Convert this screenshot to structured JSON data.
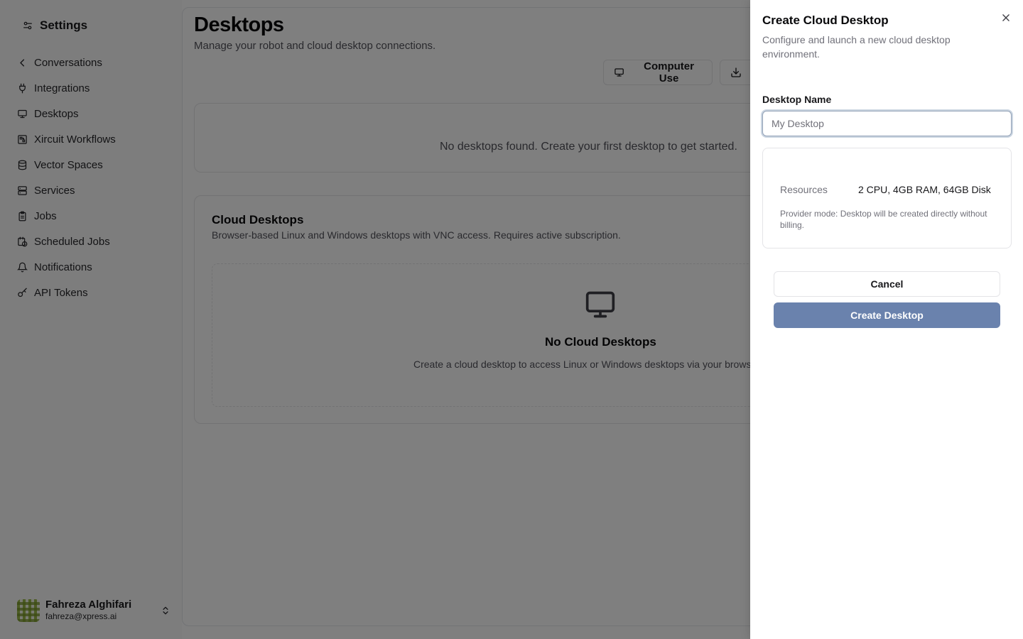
{
  "sidebar": {
    "title": "Settings",
    "title_icon": "settings-sliders-icon",
    "items": [
      {
        "label": "Conversations",
        "icon": "chevron-left-icon"
      },
      {
        "label": "Integrations",
        "icon": "plug-icon"
      },
      {
        "label": "Desktops",
        "icon": "monitor-icon"
      },
      {
        "label": "Xircuit Workflows",
        "icon": "workflow-icon"
      },
      {
        "label": "Vector Spaces",
        "icon": "database-icon"
      },
      {
        "label": "Services",
        "icon": "server-icon"
      },
      {
        "label": "Jobs",
        "icon": "clipboard-icon"
      },
      {
        "label": "Scheduled Jobs",
        "icon": "calendar-clock-icon"
      },
      {
        "label": "Notifications",
        "icon": "bell-icon"
      },
      {
        "label": "API Tokens",
        "icon": "key-icon"
      }
    ],
    "user": {
      "name": "Fahreza Alghifari",
      "email": "fahreza@xpress.ai"
    }
  },
  "main": {
    "title": "Desktops",
    "subtitle": "Manage your robot and cloud desktop connections.",
    "computer_use_label": "Computer Use",
    "empty_message": "No desktops found. Create your first desktop to get started.",
    "cloud": {
      "title": "Cloud Desktops",
      "description": "Browser-based Linux and Windows desktops with VNC access. Requires active subscription.",
      "empty_title": "No Cloud Desktops",
      "empty_description": "Create a cloud desktop to access Linux or Windows desktops via your browser."
    }
  },
  "sheet": {
    "title": "Create Cloud Desktop",
    "description": "Configure and launch a new cloud desktop environment.",
    "name_label": "Desktop Name",
    "name_placeholder": "My Desktop",
    "name_value": "",
    "resources_label": "Resources",
    "resources_value": "2 CPU, 4GB RAM, 64GB Disk",
    "provider_note": "Provider mode: Desktop will be created directly without billing.",
    "cancel_label": "Cancel",
    "create_label": "Create Desktop"
  },
  "colors": {
    "primary_button": "#6a82ad",
    "overlay": "rgba(0,0,0,0.5)",
    "sidebar_bg": "#fafafa"
  }
}
